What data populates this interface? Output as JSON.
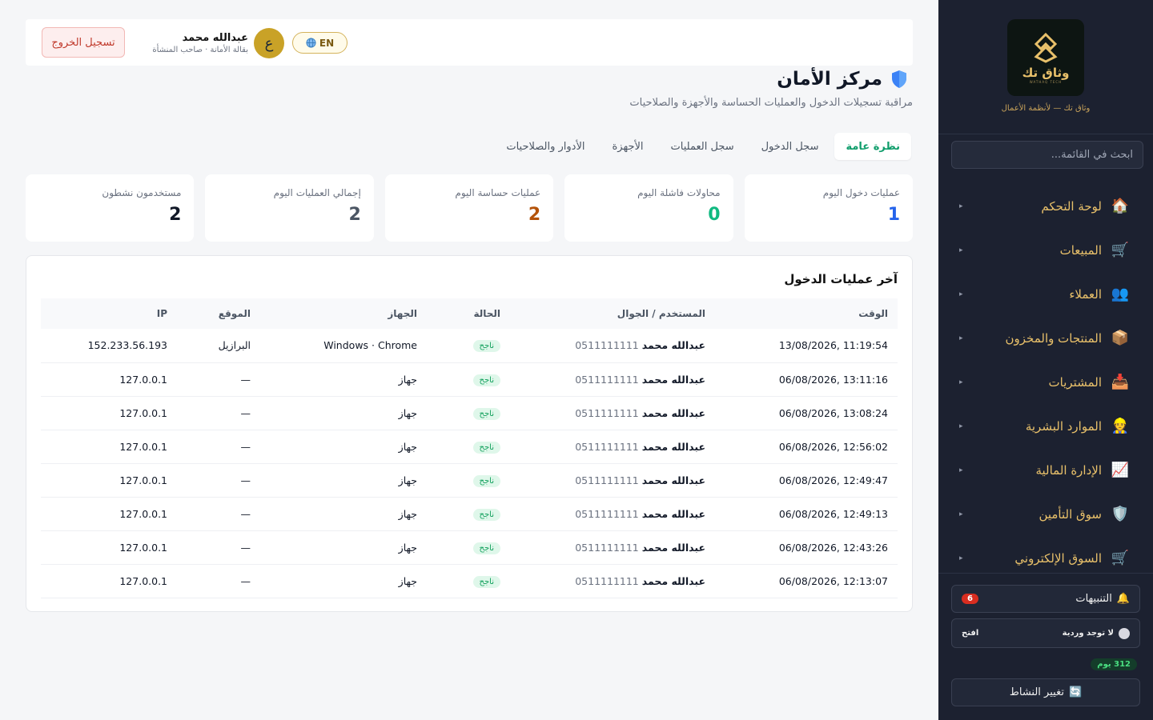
{
  "sidebar": {
    "brand_name": "وثاق تك",
    "brand_sub": "WATHAQ TECH",
    "tagline": "وثاق تك — لأنظمة الأعمال",
    "search_placeholder": "ابحث في القائمة...",
    "items": [
      {
        "label": "لوحة التحكم",
        "icon": "home-icon",
        "glyph": "🏠"
      },
      {
        "label": "المبيعات",
        "icon": "cart-icon",
        "glyph": "🛒"
      },
      {
        "label": "العملاء",
        "icon": "users-icon",
        "glyph": "👥"
      },
      {
        "label": "المنتجات والمخزون",
        "icon": "box-icon",
        "glyph": "📦"
      },
      {
        "label": "المشتريات",
        "icon": "inbox-icon",
        "glyph": "📥"
      },
      {
        "label": "الموارد البشرية",
        "icon": "person-icon",
        "glyph": "👷"
      },
      {
        "label": "الإدارة المالية",
        "icon": "chart-icon",
        "glyph": "📈"
      },
      {
        "label": "سوق التأمين",
        "icon": "shield-icon",
        "glyph": "🛡️"
      },
      {
        "label": "السوق الإلكتروني",
        "icon": "cart-icon",
        "glyph": "🛒"
      }
    ],
    "alerts_label": "التنبيهات",
    "alerts_count": "6",
    "shift_status": "لا توجد وردية",
    "shift_open": "افتح",
    "days_remaining": "312 يوم",
    "switch_activity": "تغيير النشاط"
  },
  "header": {
    "logout": "تسجيل الخروج",
    "user_name": "عبدالله محمد",
    "user_role": "بقالة الأمانة · صاحب المنشأة",
    "avatar_letter": "ع",
    "lang": "EN"
  },
  "page": {
    "title": "مركز الأمان",
    "subtitle": "مراقبة تسجيلات الدخول والعمليات الحساسة والأجهزة والصلاحيات"
  },
  "tabs": [
    "نظرة عامة",
    "سجل الدخول",
    "سجل العمليات",
    "الأجهزة",
    "الأدوار والصلاحيات"
  ],
  "stats": [
    {
      "label": "عمليات دخول اليوم",
      "value": "1",
      "color": "#2563eb"
    },
    {
      "label": "محاولات فاشلة اليوم",
      "value": "0",
      "color": "#10b981"
    },
    {
      "label": "عمليات حساسة اليوم",
      "value": "2",
      "color": "#b45309"
    },
    {
      "label": "إجمالي العمليات اليوم",
      "value": "2",
      "color": "#4b5563"
    },
    {
      "label": "مستخدمون نشطون",
      "value": "2",
      "color": "#111827"
    }
  ],
  "logins": {
    "title": "آخر عمليات الدخول",
    "columns": [
      "الوقت",
      "المستخدم / الجوال",
      "الحالة",
      "الجهاز",
      "الموقع",
      "IP"
    ],
    "rows": [
      {
        "time": "13/08/2026, 11:19:54",
        "user": "عبدالله محمد",
        "phone": "0511111111",
        "status": "ناجح",
        "device": "Windows · Chrome",
        "location": "البرازيل",
        "ip": "152.233.56.193"
      },
      {
        "time": "06/08/2026, 13:11:16",
        "user": "عبدالله محمد",
        "phone": "0511111111",
        "status": "ناجح",
        "device": "جهاز",
        "location": "—",
        "ip": "127.0.0.1"
      },
      {
        "time": "06/08/2026, 13:08:24",
        "user": "عبدالله محمد",
        "phone": "0511111111",
        "status": "ناجح",
        "device": "جهاز",
        "location": "—",
        "ip": "127.0.0.1"
      },
      {
        "time": "06/08/2026, 12:56:02",
        "user": "عبدالله محمد",
        "phone": "0511111111",
        "status": "ناجح",
        "device": "جهاز",
        "location": "—",
        "ip": "127.0.0.1"
      },
      {
        "time": "06/08/2026, 12:49:47",
        "user": "عبدالله محمد",
        "phone": "0511111111",
        "status": "ناجح",
        "device": "جهاز",
        "location": "—",
        "ip": "127.0.0.1"
      },
      {
        "time": "06/08/2026, 12:49:13",
        "user": "عبدالله محمد",
        "phone": "0511111111",
        "status": "ناجح",
        "device": "جهاز",
        "location": "—",
        "ip": "127.0.0.1"
      },
      {
        "time": "06/08/2026, 12:43:26",
        "user": "عبدالله محمد",
        "phone": "0511111111",
        "status": "ناجح",
        "device": "جهاز",
        "location": "—",
        "ip": "127.0.0.1"
      },
      {
        "time": "06/08/2026, 12:13:07",
        "user": "عبدالله محمد",
        "phone": "0511111111",
        "status": "ناجح",
        "device": "جهاز",
        "location": "—",
        "ip": "127.0.0.1"
      }
    ]
  }
}
